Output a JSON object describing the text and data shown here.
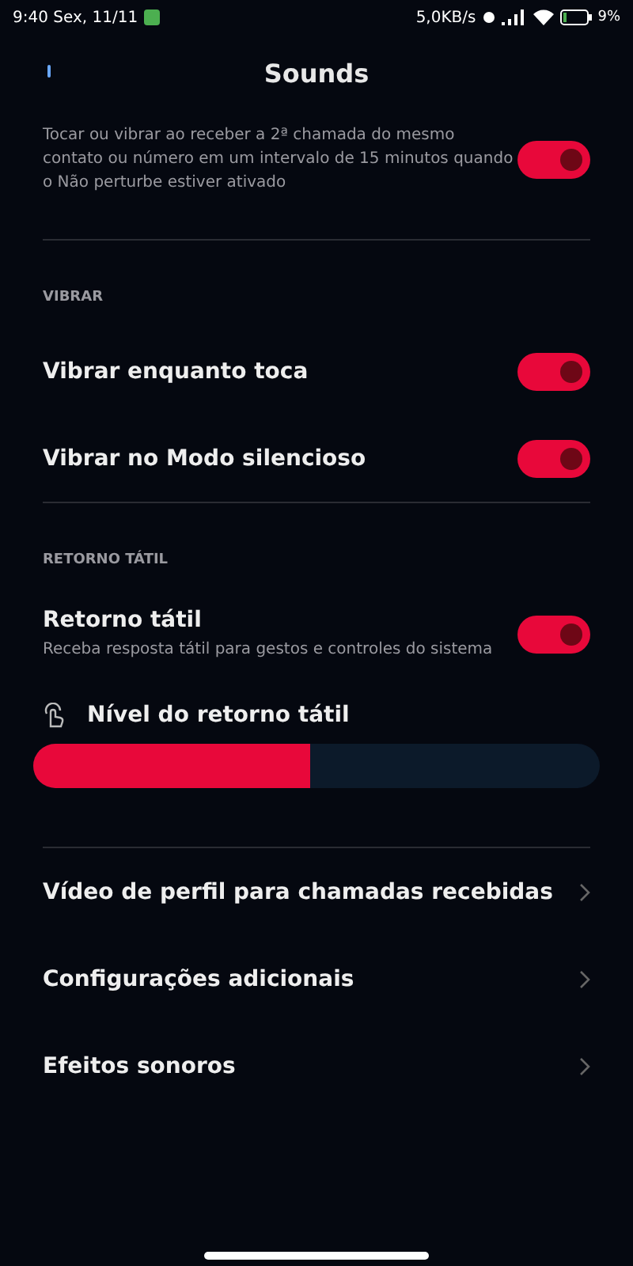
{
  "status_bar": {
    "time": "9:40 Sex, 11/11",
    "network_speed": "5,0KB/s",
    "battery": "9%"
  },
  "header": {
    "title": "Sounds"
  },
  "top_setting": {
    "description": "Tocar ou vibrar ao receber a 2ª chamada do mesmo contato ou número em um intervalo de 15 minutos quando o Não perturbe estiver ativado",
    "on": true
  },
  "sections": [
    {
      "heading": "VIBRAR",
      "items": [
        {
          "label": "Vibrar enquanto toca",
          "on": true
        },
        {
          "label": "Vibrar no Modo silencioso",
          "on": true
        }
      ]
    },
    {
      "heading": "RETORNO TÁTIL",
      "items": [
        {
          "label": "Retorno tátil",
          "description": "Receba resposta tátil para gestos e controles do sistema",
          "on": true
        }
      ]
    }
  ],
  "haptic_level": {
    "label": "Nível do retorno tátil",
    "level": 0.49
  },
  "links": [
    {
      "label": "Vídeo de perfil para chamadas recebidas"
    },
    {
      "label": "Configurações adicionais"
    },
    {
      "label": "Efeitos sonoros"
    }
  ]
}
